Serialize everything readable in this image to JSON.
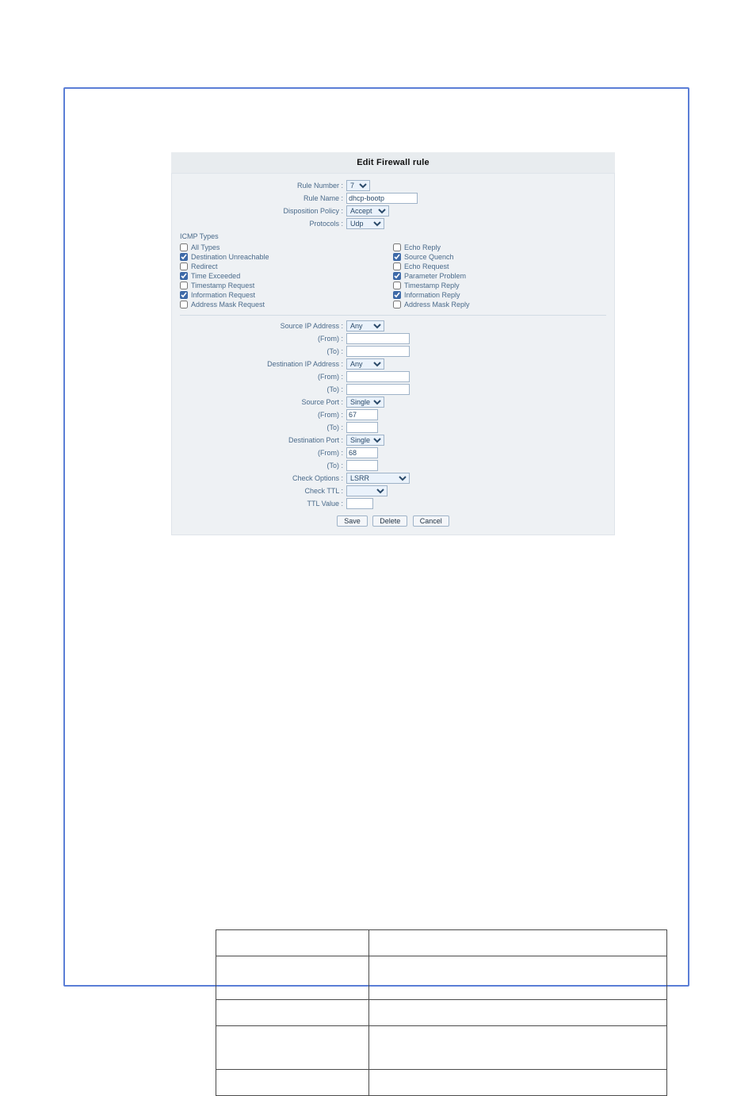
{
  "header": {
    "title": "Edit Firewall rule"
  },
  "form": {
    "rule_number": {
      "label": "Rule Number :",
      "value": "7"
    },
    "rule_name": {
      "label": "Rule Name :",
      "value": "dhcp-bootp"
    },
    "disposition": {
      "label": "Disposition Policy :",
      "value": "Accept"
    },
    "protocols": {
      "label": "Protocols :",
      "value": "Udp"
    }
  },
  "icmp": {
    "heading": "ICMP Types",
    "left": [
      {
        "label": "All Types",
        "checked": false
      },
      {
        "label": "Destination Unreachable",
        "checked": true
      },
      {
        "label": "Redirect",
        "checked": false
      },
      {
        "label": "Time Exceeded",
        "checked": true
      },
      {
        "label": "Timestamp Request",
        "checked": false
      },
      {
        "label": "Information Request",
        "checked": true
      },
      {
        "label": "Address Mask Request",
        "checked": false
      }
    ],
    "right": [
      {
        "label": "Echo Reply",
        "checked": false
      },
      {
        "label": "Source Quench",
        "checked": true
      },
      {
        "label": "Echo Request",
        "checked": false
      },
      {
        "label": "Parameter Problem",
        "checked": true
      },
      {
        "label": "Timestamp Reply",
        "checked": false
      },
      {
        "label": "Information Reply",
        "checked": true
      },
      {
        "label": "Address Mask Reply",
        "checked": false
      }
    ]
  },
  "addr": {
    "src_ip": {
      "label": "Source IP Address :",
      "value": "Any"
    },
    "src_from": {
      "label": "(From) :",
      "value": ""
    },
    "src_to": {
      "label": "(To) :",
      "value": ""
    },
    "dst_ip": {
      "label": "Destination IP Address :",
      "value": "Any"
    },
    "dst_from": {
      "label": "(From) :",
      "value": ""
    },
    "dst_to": {
      "label": "(To) :",
      "value": ""
    },
    "src_port": {
      "label": "Source Port :",
      "value": "Single"
    },
    "sp_from": {
      "label": "(From) :",
      "value": "67"
    },
    "sp_to": {
      "label": "(To) :",
      "value": ""
    },
    "dst_port": {
      "label": "Destination Port :",
      "value": "Single"
    },
    "dp_from": {
      "label": "(From) :",
      "value": "68"
    },
    "dp_to": {
      "label": "(To) :",
      "value": ""
    },
    "chk_opt": {
      "label": "Check Options :",
      "value": "LSRR"
    },
    "chk_ttl": {
      "label": "Check TTL :",
      "value": ""
    },
    "ttl_val": {
      "label": "TTL Value :",
      "value": ""
    }
  },
  "buttons": {
    "save": "Save",
    "delete": "Delete",
    "cancel": "Cancel"
  }
}
